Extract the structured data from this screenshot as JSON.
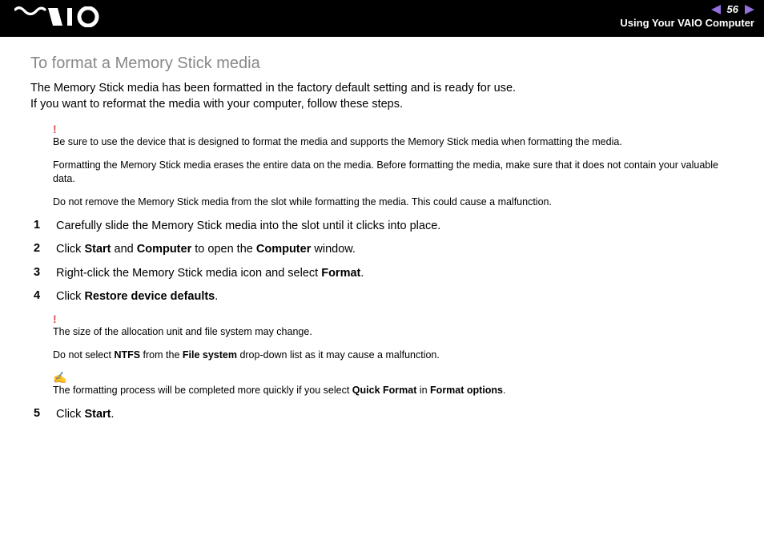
{
  "header": {
    "page_number": "56",
    "section": "Using Your VAIO Computer"
  },
  "title": "To format a Memory Stick media",
  "intro_line1": "The Memory Stick media has been formatted in the factory default setting and is ready for use.",
  "intro_line2": "If you want to reformat the media with your computer, follow these steps.",
  "warning1": {
    "p1": "Be sure to use the device that is designed to format the media and supports the Memory Stick media when formatting the media.",
    "p2": "Formatting the Memory Stick media erases the entire data on the media. Before formatting the media, make sure that it does not contain your valuable data.",
    "p3": "Do not remove the Memory Stick media from the slot while formatting the media. This could cause a malfunction."
  },
  "steps": {
    "s1": {
      "num": "1",
      "text": "Carefully slide the Memory Stick media into the slot until it clicks into place."
    },
    "s2": {
      "num": "2",
      "pre": "Click ",
      "b1": "Start",
      "mid1": " and ",
      "b2": "Computer",
      "mid2": " to open the ",
      "b3": "Computer",
      "post": " window."
    },
    "s3": {
      "num": "3",
      "pre": "Right-click the Memory Stick media icon and select ",
      "b1": "Format",
      "post": "."
    },
    "s4": {
      "num": "4",
      "pre": "Click ",
      "b1": "Restore device defaults",
      "post": "."
    },
    "s5": {
      "num": "5",
      "pre": "Click ",
      "b1": "Start",
      "post": "."
    }
  },
  "warning2": {
    "p1": "The size of the allocation unit and file system may change.",
    "p2_pre": "Do not select ",
    "p2_b1": "NTFS",
    "p2_mid": " from the ",
    "p2_b2": "File system",
    "p2_post": " drop-down list as it may cause a malfunction."
  },
  "tip": {
    "pre": "The formatting process will be completed more quickly if you select ",
    "b1": "Quick Format",
    "mid": " in ",
    "b2": "Format options",
    "post": "."
  }
}
